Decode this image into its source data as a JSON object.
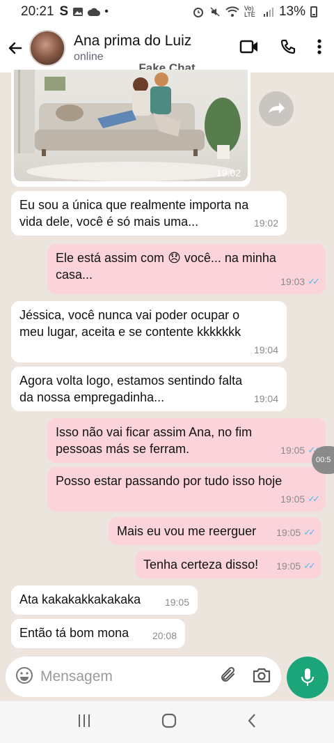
{
  "status_bar": {
    "time": "20:21",
    "network_label": "Vo) LTE",
    "battery": "13%"
  },
  "header": {
    "contact_name": "Ana prima do Luiz",
    "presence": "online",
    "watermark": "Fake Chat"
  },
  "messages": [
    {
      "side": "in",
      "type": "image",
      "time": "19:02"
    },
    {
      "side": "in",
      "text": "Eu sou a única que realmente importa na vida dele, você é só mais uma...",
      "time": "19:02"
    },
    {
      "side": "out",
      "text_before": "Ele está assim com",
      "emoji": "😞",
      "text_after": "você... na minha casa...",
      "time": "19:03"
    },
    {
      "side": "in",
      "text": "Jéssica, você nunca vai poder ocupar o meu lugar, aceita e se contente kkkkkkk",
      "time": "19:04"
    },
    {
      "side": "in",
      "text": "Agora volta logo, estamos sentindo falta da nossa empregadinha...",
      "time": "19:04"
    },
    {
      "side": "out",
      "text": "Isso não vai ficar assim Ana, no fim pessoas más se ferram.",
      "time": "19:05"
    },
    {
      "side": "out",
      "text": "Posso estar passando por tudo isso hoje",
      "time": "19:05"
    },
    {
      "side": "out",
      "text": "Mais eu vou me reerguer",
      "time": "19:05"
    },
    {
      "side": "out",
      "text": "Tenha certeza disso!",
      "time": "19:05"
    },
    {
      "side": "in",
      "text": "Ata kakakakkakakaka",
      "time": "19:05"
    },
    {
      "side": "in",
      "text": "Então tá bom mona",
      "time": "20:08"
    }
  ],
  "timer": "00:5",
  "input": {
    "placeholder": "Mensagem"
  },
  "colors": {
    "outgoing_bubble": "#fbd3da",
    "incoming_bubble": "#ffffff",
    "chat_bg": "#ece5dd",
    "mic_button": "#1da57a",
    "read_ticks": "#53bdeb"
  },
  "icons": [
    "back-arrow-icon",
    "video-call-icon",
    "phone-icon",
    "more-vert-icon",
    "forward-icon",
    "emoji-icon",
    "attach-icon",
    "camera-icon",
    "mic-icon"
  ]
}
